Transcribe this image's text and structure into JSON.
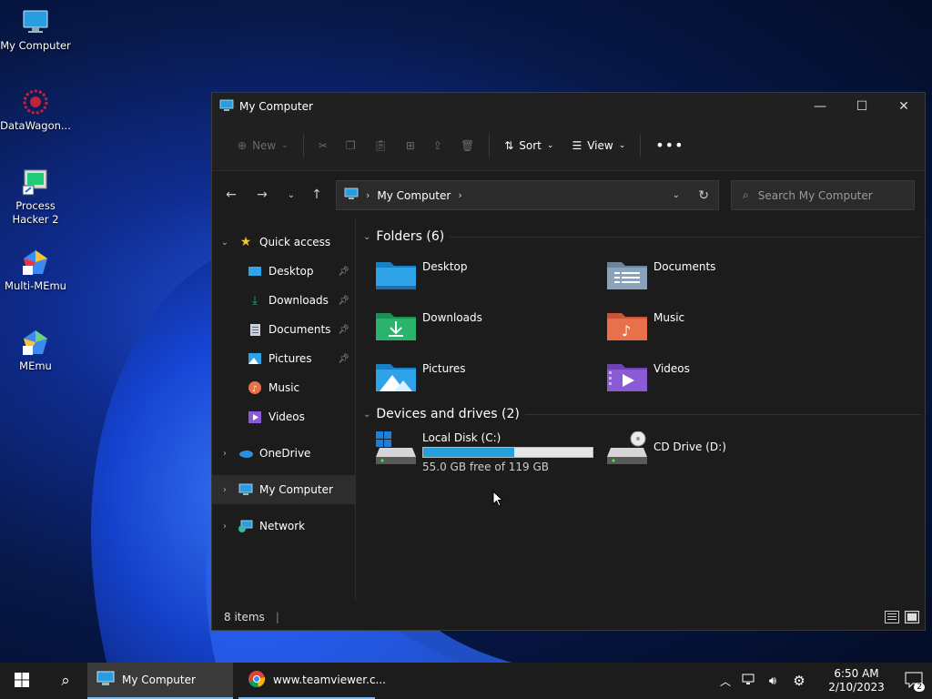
{
  "desktop": {
    "icons": [
      {
        "label": "My Computer",
        "icon": "monitor-icon"
      },
      {
        "label": "DataWagon...",
        "icon": "datawagon-icon"
      },
      {
        "label": "Process Hacker 2",
        "icon": "process-hacker-icon"
      },
      {
        "label": "Multi-MEmu",
        "icon": "multi-memu-icon"
      },
      {
        "label": "MEmu",
        "icon": "memu-icon"
      }
    ]
  },
  "window": {
    "title": "My Computer",
    "toolbar": {
      "new_label": "New",
      "sort_label": "Sort",
      "view_label": "View"
    },
    "address": {
      "segment": "My Computer"
    },
    "search": {
      "placeholder": "Search My Computer"
    },
    "sidebar": {
      "quick_access": "Quick access",
      "quick_items": [
        {
          "label": "Desktop",
          "pinned": true
        },
        {
          "label": "Downloads",
          "pinned": true
        },
        {
          "label": "Documents",
          "pinned": true
        },
        {
          "label": "Pictures",
          "pinned": true
        },
        {
          "label": "Music",
          "pinned": false
        },
        {
          "label": "Videos",
          "pinned": false
        }
      ],
      "onedrive": "OneDrive",
      "my_computer": "My Computer",
      "network": "Network"
    },
    "folders_header": "Folders (6)",
    "folders": [
      {
        "label": "Desktop",
        "icon": "desktop-folder-icon",
        "color": "#2fa3e8"
      },
      {
        "label": "Documents",
        "icon": "documents-folder-icon",
        "color": "#8aa3bd"
      },
      {
        "label": "Downloads",
        "icon": "downloads-folder-icon",
        "color": "#29b36b"
      },
      {
        "label": "Music",
        "icon": "music-folder-icon",
        "color": "#e8704a"
      },
      {
        "label": "Pictures",
        "icon": "pictures-folder-icon",
        "color": "#2fa3e8"
      },
      {
        "label": "Videos",
        "icon": "videos-folder-icon",
        "color": "#8b5bd6"
      }
    ],
    "drives_header": "Devices and drives (2)",
    "drives": {
      "c": {
        "label": "Local Disk (C:)",
        "free_text": "55.0 GB free of 119 GB",
        "used_fraction": 0.54
      },
      "d": {
        "label": "CD Drive (D:)"
      }
    },
    "status": {
      "items": "8 items"
    }
  },
  "taskbar": {
    "explorer_label": "My Computer",
    "chrome_label": "www.teamviewer.c...",
    "time": "6:50 AM",
    "date": "2/10/2023",
    "notifications": "2"
  },
  "colors": {
    "accent": "#2fa3e8",
    "drive_bar": "#26a0da"
  }
}
